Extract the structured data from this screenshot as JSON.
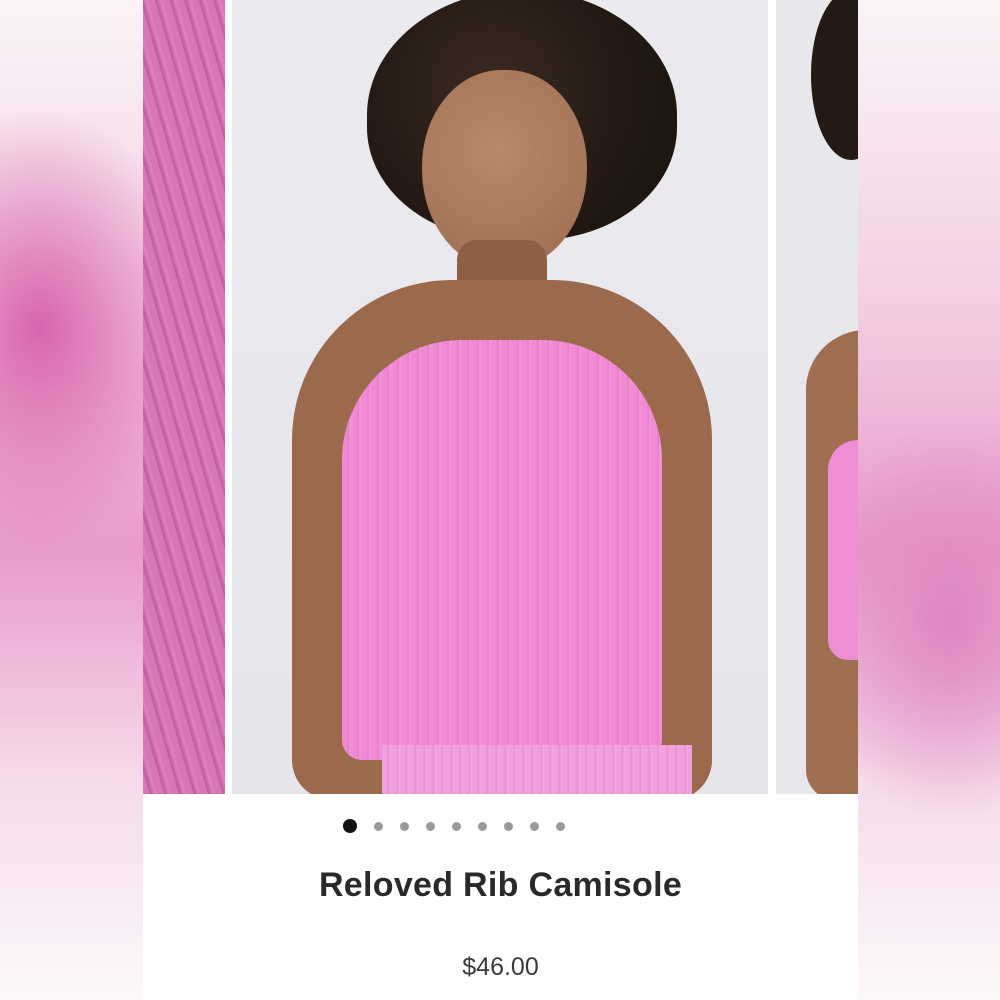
{
  "product": {
    "title": "Reloved Rib Camisole",
    "price": "$46.00"
  },
  "gallery": {
    "total_images": 9,
    "active_index": 0,
    "zoom_icon": "magnifier-icon"
  },
  "colors": {
    "product_pink": "#f08ad4",
    "active_dot": "#111111",
    "inactive_dot": "#9a9a9a"
  }
}
